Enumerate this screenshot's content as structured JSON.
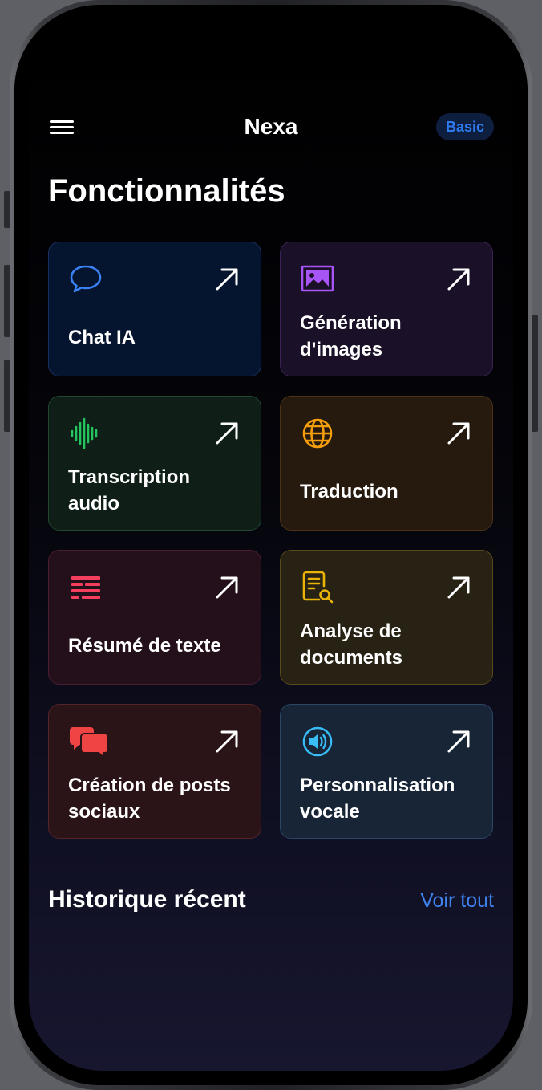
{
  "header": {
    "title": "Nexa",
    "plan_badge": "Basic"
  },
  "features": {
    "title": "Fonctionnalités",
    "items": [
      {
        "label": "Chat IA",
        "icon": "chat-bubble-icon",
        "color": "#3b82f6"
      },
      {
        "label": "Génération d'images",
        "icon": "image-icon",
        "color": "#a855f7"
      },
      {
        "label": "Transcription audio",
        "icon": "waveform-icon",
        "color": "#22c55e"
      },
      {
        "label": "Traduction",
        "icon": "globe-icon",
        "color": "#f59e0b"
      },
      {
        "label": "Résumé de texte",
        "icon": "text-lines-icon",
        "color": "#f43f5e"
      },
      {
        "label": "Analyse de documents",
        "icon": "document-search-icon",
        "color": "#eab308"
      },
      {
        "label": "Création de posts sociaux",
        "icon": "chat-bubbles-icon",
        "color": "#ef4444"
      },
      {
        "label": "Personnalisation vocale",
        "icon": "speaker-icon",
        "color": "#38bdf8"
      }
    ]
  },
  "history": {
    "title": "Historique récent",
    "see_all": "Voir tout"
  }
}
